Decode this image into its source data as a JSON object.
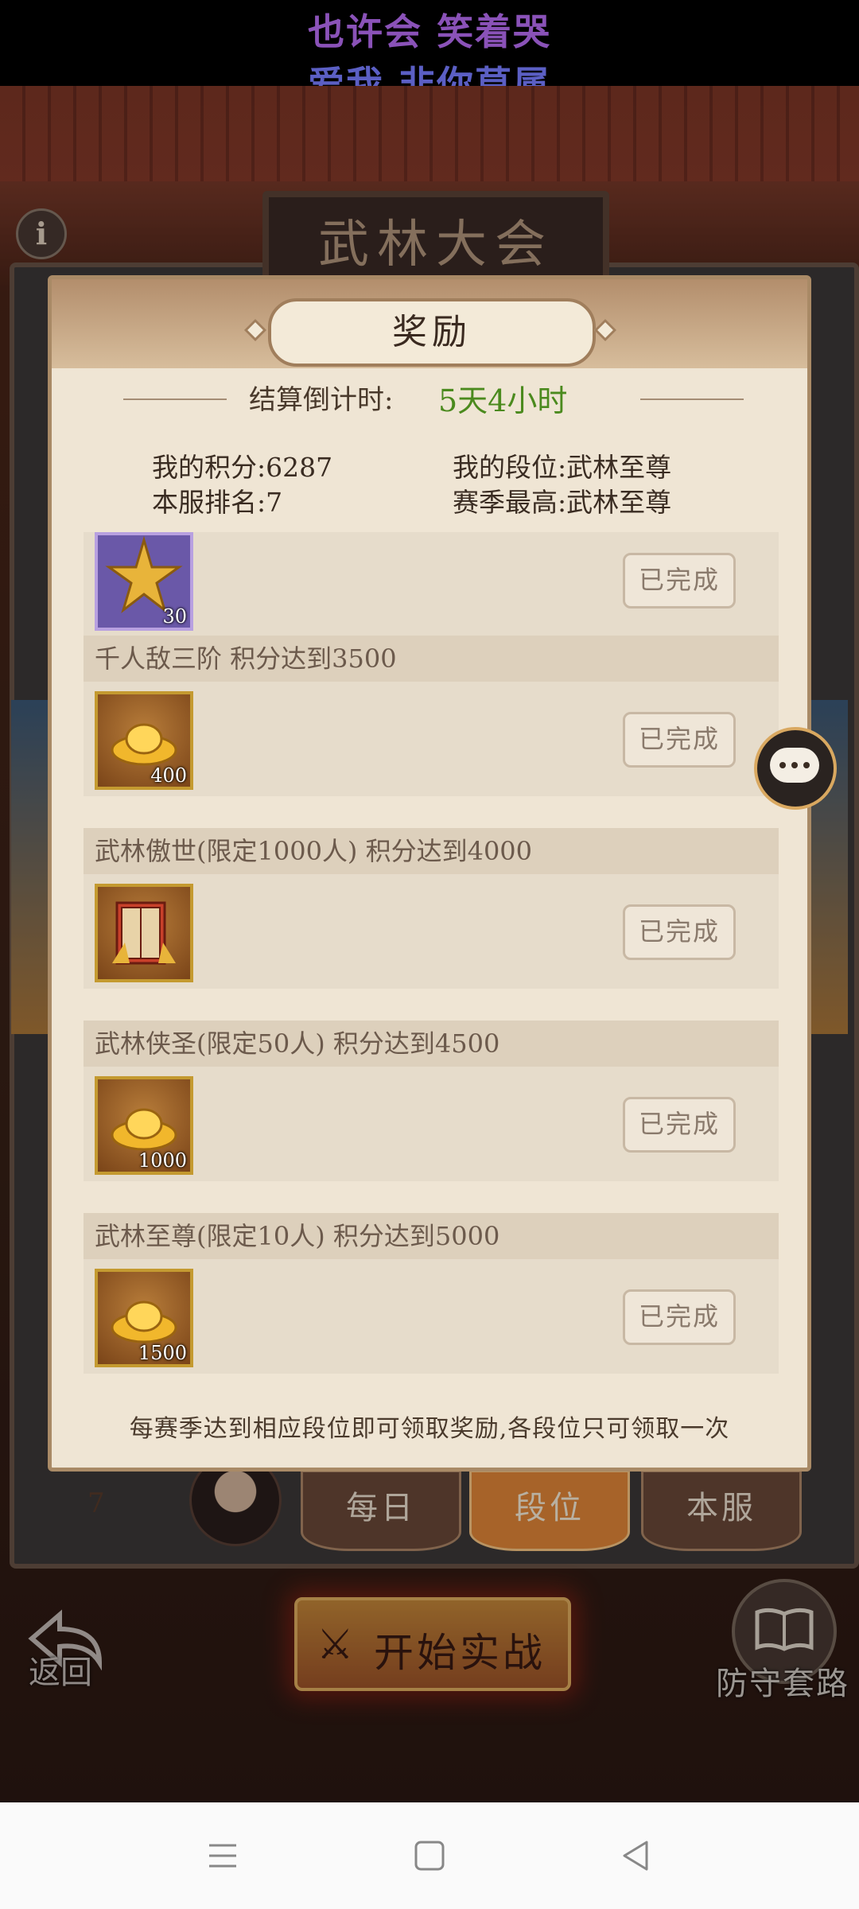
{
  "lyrics": {
    "line1": "也许会 笑着哭",
    "line2": "爱我 非你莫属"
  },
  "scene": {
    "plaque_text": "武林大会",
    "info_icon_glyph": "i",
    "rank_number": "7",
    "tabs": {
      "daily": "每日",
      "rank": "段位",
      "server": "本服"
    },
    "back_label": "返回",
    "start_label": "开始实战",
    "defense_label": "防守套路"
  },
  "modal": {
    "title": "奖励",
    "countdown_label": "结算倒计时:",
    "countdown_value": "5天4小时",
    "stats": {
      "my_score": "我的积分:6287",
      "server_rank": "本服排名:7",
      "my_tier": "我的段位:武林至尊",
      "season_best": "赛季最高:武林至尊"
    },
    "rewards": [
      {
        "header": "",
        "count": "30",
        "status": "已完成",
        "icon": "gold-star-icon"
      },
      {
        "header": "千人敌三阶 积分达到3500",
        "count": "400",
        "status": "已完成",
        "icon": "gold-ingot-icon"
      },
      {
        "header": "武林傲世(限定1000人) 积分达到4000",
        "count": "",
        "status": "已完成",
        "icon": "treasure-chest-icon"
      },
      {
        "header": "武林侠圣(限定50人) 积分达到4500",
        "count": "1000",
        "status": "已完成",
        "icon": "gold-ingot-icon"
      },
      {
        "header": "武林至尊(限定10人) 积分达到5000",
        "count": "1500",
        "status": "已完成",
        "icon": "gold-ingot-icon"
      }
    ],
    "footer_note": "每赛季达到相应段位即可领取奖励,各段位只可领取一次"
  },
  "colors": {
    "countdown_green": "#4b8a1e",
    "accent_orange": "#e88a3a"
  }
}
